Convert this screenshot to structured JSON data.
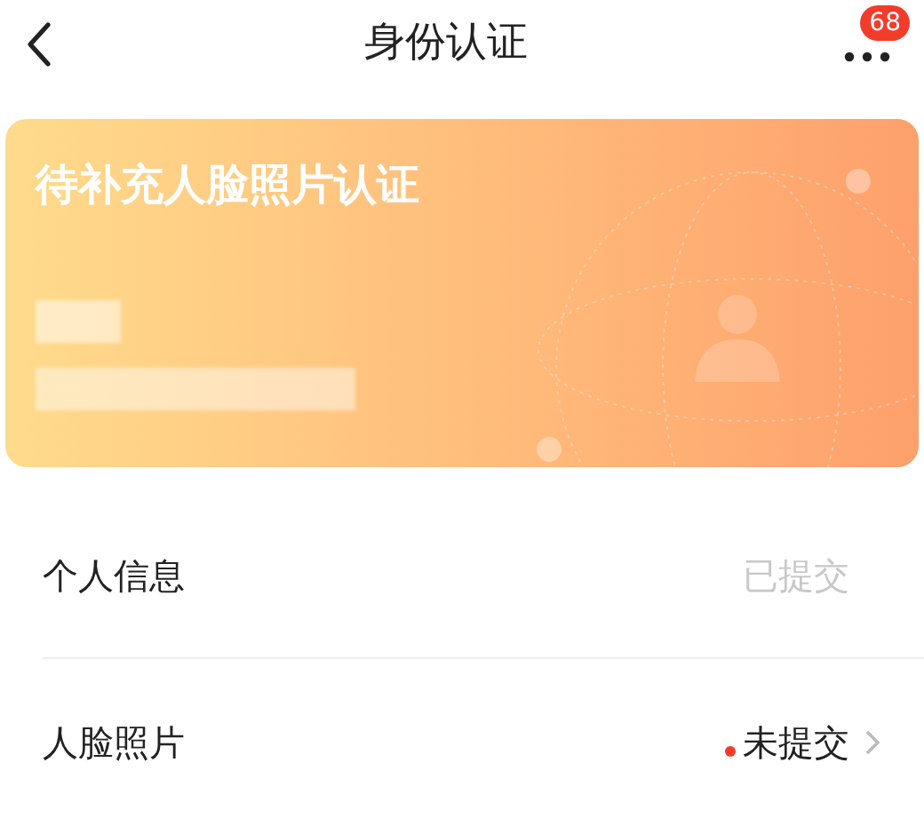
{
  "header": {
    "title": "身份认证",
    "badge": "68"
  },
  "card": {
    "title": "待补充人脸照片认证"
  },
  "items": [
    {
      "label": "个人信息",
      "status": "已提交",
      "submitted": true
    },
    {
      "label": "人脸照片",
      "status": "未提交",
      "submitted": false
    }
  ]
}
